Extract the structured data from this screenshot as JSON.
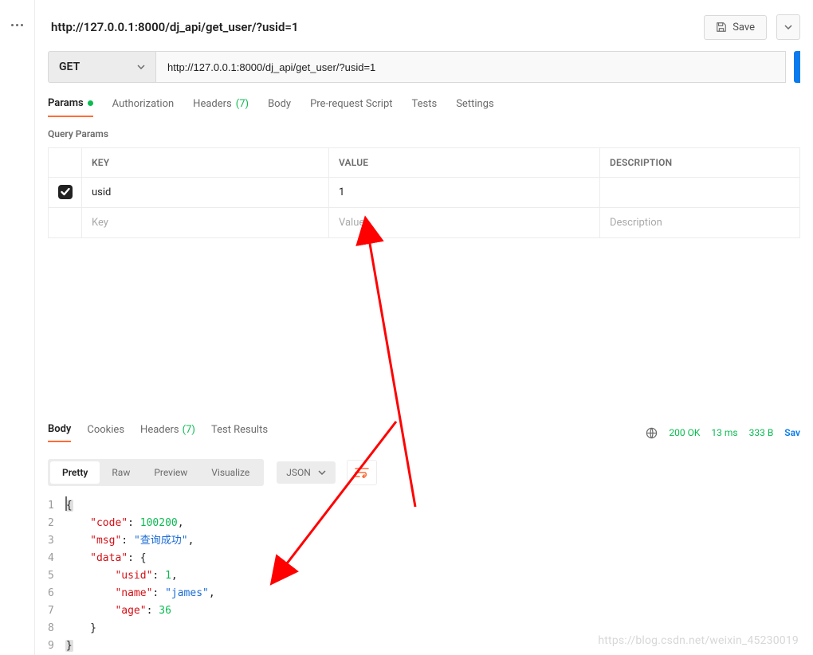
{
  "title": "http://127.0.0.1:8000/dj_api/get_user/?usid=1",
  "save_label": "Save",
  "method": "GET",
  "url": "http://127.0.0.1:8000/dj_api/get_user/?usid=1",
  "req_tabs": {
    "params": "Params",
    "authorization": "Authorization",
    "headers": "Headers",
    "headers_count": "(7)",
    "body": "Body",
    "pre": "Pre-request Script",
    "tests": "Tests",
    "settings": "Settings"
  },
  "query_params_label": "Query Params",
  "table": {
    "head": {
      "key": "KEY",
      "value": "VALUE",
      "desc": "DESCRIPTION"
    },
    "rows": [
      {
        "enabled": true,
        "key": "usid",
        "value": "1",
        "desc": ""
      }
    ],
    "placeholder": {
      "key": "Key",
      "value": "Value",
      "desc": "Description"
    }
  },
  "resp_tabs": {
    "body": "Body",
    "cookies": "Cookies",
    "headers": "Headers",
    "headers_count": "(7)",
    "tests": "Test Results"
  },
  "resp_meta": {
    "status": "200 OK",
    "time": "13 ms",
    "size": "333 B",
    "save": "Sav"
  },
  "view": {
    "pretty": "Pretty",
    "raw": "Raw",
    "preview": "Preview",
    "visualize": "Visualize",
    "lang": "JSON"
  },
  "response_body": {
    "code": 100200,
    "msg": "查询成功",
    "data": {
      "usid": 1,
      "name": "james",
      "age": 36
    }
  },
  "watermark": "https://blog.csdn.net/weixin_45230019"
}
